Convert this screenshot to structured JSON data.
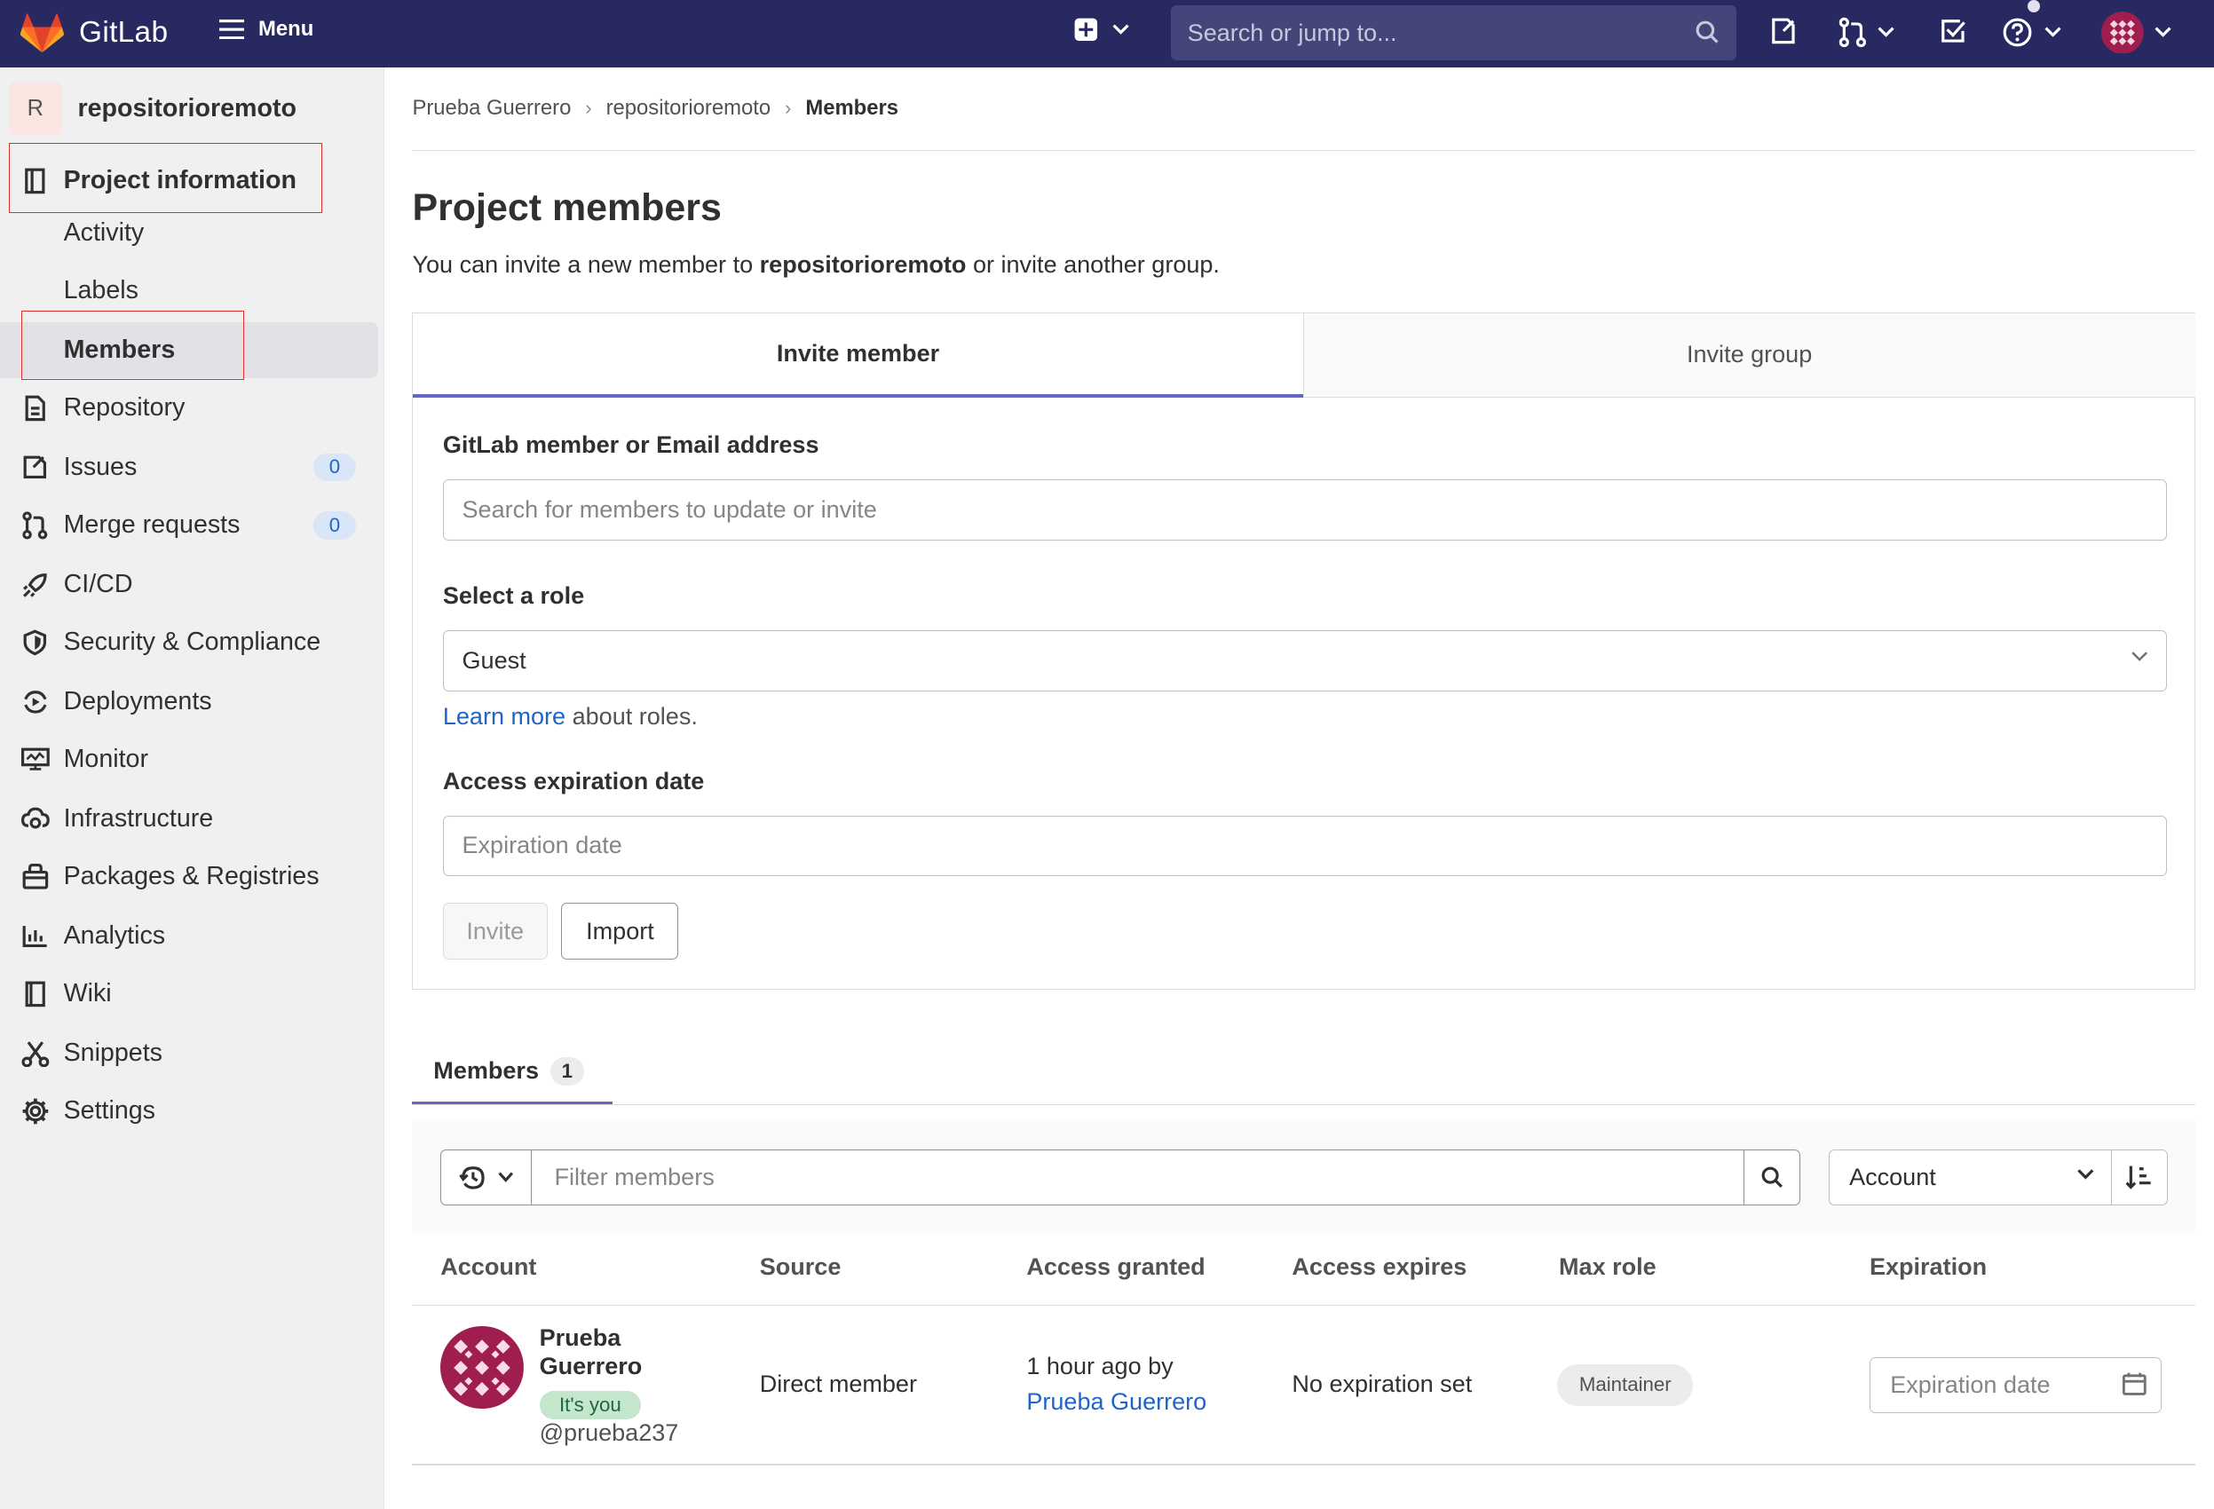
{
  "topbar": {
    "brand": "GitLab",
    "menu_label": "Menu",
    "search_placeholder": "Search or jump to..."
  },
  "sidebar": {
    "project_initial": "R",
    "project_name": "repositorioremoto",
    "section_title": "Project information",
    "sub_items": [
      {
        "label": "Activity"
      },
      {
        "label": "Labels"
      },
      {
        "label": "Members"
      }
    ],
    "items": [
      {
        "label": "Repository",
        "icon": "doc-icon"
      },
      {
        "label": "Issues",
        "icon": "issues-icon",
        "count": "0"
      },
      {
        "label": "Merge requests",
        "icon": "merge-request-icon",
        "count": "0"
      },
      {
        "label": "CI/CD",
        "icon": "rocket-icon"
      },
      {
        "label": "Security & Compliance",
        "icon": "shield-icon"
      },
      {
        "label": "Deployments",
        "icon": "deployments-icon"
      },
      {
        "label": "Monitor",
        "icon": "monitor-icon"
      },
      {
        "label": "Infrastructure",
        "icon": "cloud-gear-icon"
      },
      {
        "label": "Packages & Registries",
        "icon": "package-icon"
      },
      {
        "label": "Analytics",
        "icon": "chart-icon"
      },
      {
        "label": "Wiki",
        "icon": "book-icon"
      },
      {
        "label": "Snippets",
        "icon": "scissors-icon"
      },
      {
        "label": "Settings",
        "icon": "gear-icon"
      }
    ]
  },
  "breadcrumb": [
    "Prueba Guerrero",
    "repositorioremoto",
    "Members"
  ],
  "page": {
    "title": "Project members",
    "intro_prefix": "You can invite a new member to ",
    "intro_project": "repositorioremoto",
    "intro_suffix": " or invite another group."
  },
  "invite": {
    "tab_member": "Invite member",
    "tab_group": "Invite group",
    "member_label": "GitLab member or Email address",
    "member_placeholder": "Search for members to update or invite",
    "role_label": "Select a role",
    "role_value": "Guest",
    "learn_more_link": "Learn more",
    "learn_more_suffix": " about roles.",
    "expiration_label": "Access expiration date",
    "expiration_placeholder": "Expiration date",
    "invite_button": "Invite",
    "import_button": "Import"
  },
  "members": {
    "tab_label": "Members",
    "count": "1",
    "filter_placeholder": "Filter members",
    "sort_value": "Account",
    "columns": [
      "Account",
      "Source",
      "Access granted",
      "Access expires",
      "Max role",
      "Expiration"
    ],
    "rows": [
      {
        "name": "Prueba Guerrero",
        "badge": "It's you",
        "username": "@prueba237",
        "source": "Direct member",
        "granted": "1 hour ago by",
        "granted_by": "Prueba Guerrero",
        "expires": "No expiration set",
        "max_role": "Maintainer",
        "expiration_placeholder": "Expiration date"
      }
    ]
  },
  "colors": {
    "topbar": "#292961",
    "accent": "#6666c4",
    "link": "#1f64c8",
    "highlight_box": "#e0322c"
  }
}
